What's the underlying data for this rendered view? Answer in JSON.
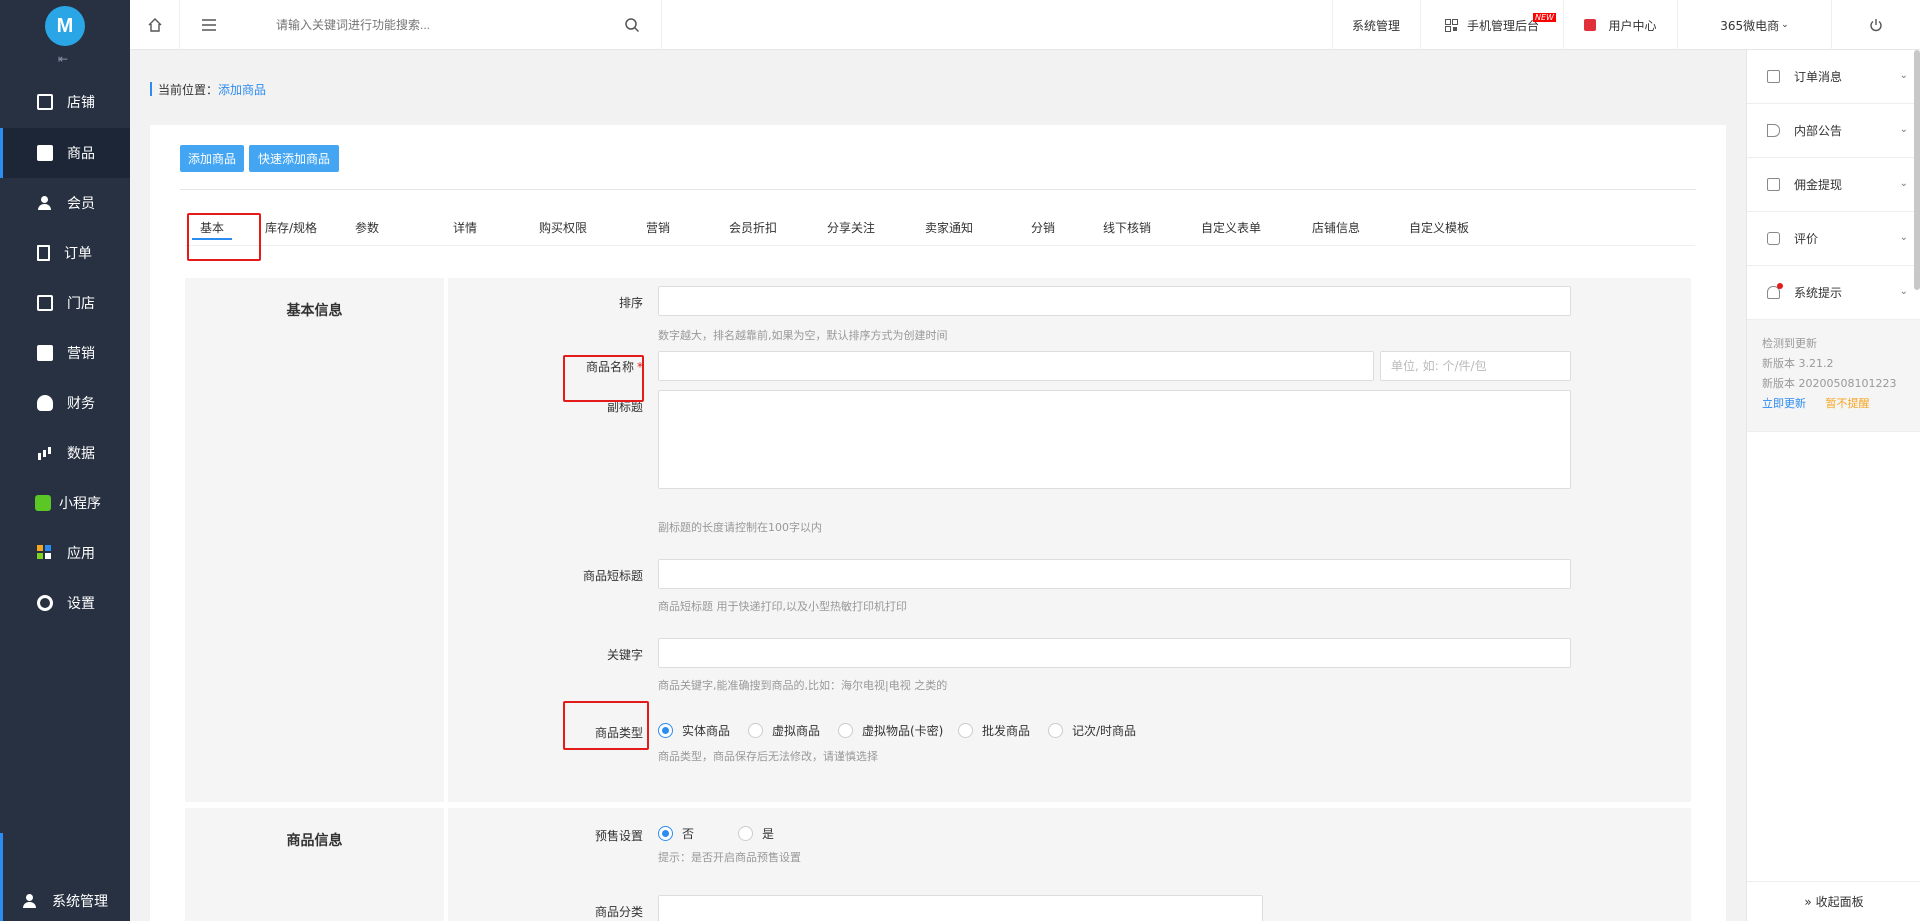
{
  "brand": {
    "logo_text": "M"
  },
  "sidebar": {
    "collapse_glyph": "⇤",
    "items": [
      {
        "label": "店铺",
        "icon": "store-icon"
      },
      {
        "label": "商品",
        "icon": "goods-icon",
        "active": true
      },
      {
        "label": "会员",
        "icon": "member-icon"
      },
      {
        "label": "订单",
        "icon": "order-icon"
      },
      {
        "label": "门店",
        "icon": "shop-icon"
      },
      {
        "label": "营销",
        "icon": "gift-icon"
      },
      {
        "label": "财务",
        "icon": "money-bag-icon"
      },
      {
        "label": "数据",
        "icon": "chart-icon"
      },
      {
        "label": "小程序",
        "icon": "mini-program-icon"
      },
      {
        "label": "应用",
        "icon": "apps-icon"
      },
      {
        "label": "设置",
        "icon": "gear-icon"
      }
    ],
    "bottom_label": "系统管理"
  },
  "topbar": {
    "search_placeholder": "请输入关键词进行功能搜索...",
    "system_manage": "系统管理",
    "mobile_admin": "手机管理后台",
    "new_badge": "NEW",
    "user_center": "用户中心",
    "shop_name": "365微电商"
  },
  "right_panel": {
    "items": [
      {
        "label": "订单消息",
        "icon": "clipboard-icon"
      },
      {
        "label": "内部公告",
        "icon": "megaphone-icon"
      },
      {
        "label": "佣金提现",
        "icon": "withdraw-icon"
      },
      {
        "label": "评价",
        "icon": "comment-icon"
      },
      {
        "label": "系统提示",
        "icon": "bell-icon"
      }
    ],
    "update": {
      "detected": "检测到更新",
      "version": "新版本 3.21.2",
      "build": "新版本 20200508101223",
      "update_now": "立即更新",
      "later": "暂不提醒"
    },
    "collapse": "» 收起面板"
  },
  "breadcrumb": {
    "prefix": "当前位置：",
    "current": "添加商品"
  },
  "buttons": {
    "add_goods": "添加商品",
    "quick_add": "快速添加商品"
  },
  "tabs": [
    "基本",
    "库存/规格",
    "参数",
    "详情",
    "购买权限",
    "营销",
    "会员折扣",
    "分享关注",
    "卖家通知",
    "分销",
    "线下核销",
    "自定义表单",
    "店铺信息",
    "自定义模板"
  ],
  "basic": {
    "title": "基本信息",
    "sort": {
      "label": "排序",
      "hint": "数字越大，排名越靠前,如果为空，默认排序方式为创建时间"
    },
    "name": {
      "label": "商品名称",
      "required_mark": "*",
      "unit_placeholder": "单位, 如: 个/件/包"
    },
    "subtitle": {
      "label": "副标题",
      "hint": "副标题的长度请控制在100字以内"
    },
    "short_title": {
      "label": "商品短标题",
      "hint": "商品短标题 用于快递打印,以及小型热敏打印机打印"
    },
    "keywords": {
      "label": "关键字",
      "hint": "商品关键字,能准确搜到商品的,比如：海尔电视|电视 之类的"
    },
    "type": {
      "label": "商品类型",
      "options": [
        "实体商品",
        "虚拟商品",
        "虚拟物品(卡密)",
        "批发商品",
        "记次/时商品"
      ],
      "selected": 0,
      "hint": "商品类型，商品保存后无法修改，请谨慎选择"
    }
  },
  "goods_info": {
    "title": "商品信息",
    "presale": {
      "label": "预售设置",
      "options": [
        "否",
        "是"
      ],
      "selected": 0,
      "hint": "提示：是否开启商品预售设置"
    },
    "category": {
      "label": "商品分类"
    }
  }
}
